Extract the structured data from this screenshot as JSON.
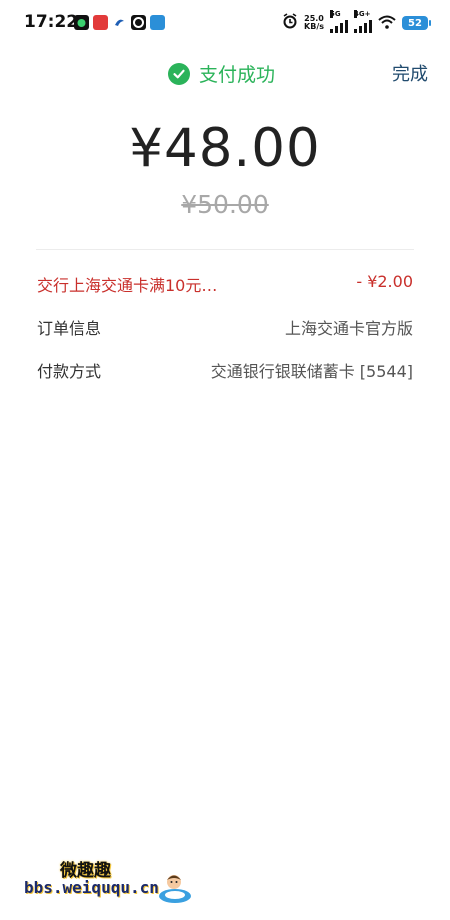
{
  "status_bar": {
    "time": "17:22",
    "net_speed_value": "25.0",
    "net_speed_unit": "KB/s",
    "signal1_label": "5G",
    "signal2_label": "4G+",
    "battery": "52"
  },
  "header": {
    "title": "支付成功",
    "done_label": "完成"
  },
  "payment": {
    "amount": "¥48.00",
    "original_amount": "¥50.00"
  },
  "details": [
    {
      "label": "交行上海交通卡满10元…",
      "value": "- ¥2.00"
    },
    {
      "label": "订单信息",
      "value": "上海交通卡官方版"
    },
    {
      "label": "付款方式",
      "value": "交通银行银联储蓄卡 [5544]"
    }
  ],
  "watermark": {
    "site_name": "微趣趣",
    "url": "bbs.weiququ.cn"
  },
  "colors": {
    "success_green": "#2bb35a",
    "discount_red": "#c9302c",
    "done_blue": "#214b6e"
  }
}
